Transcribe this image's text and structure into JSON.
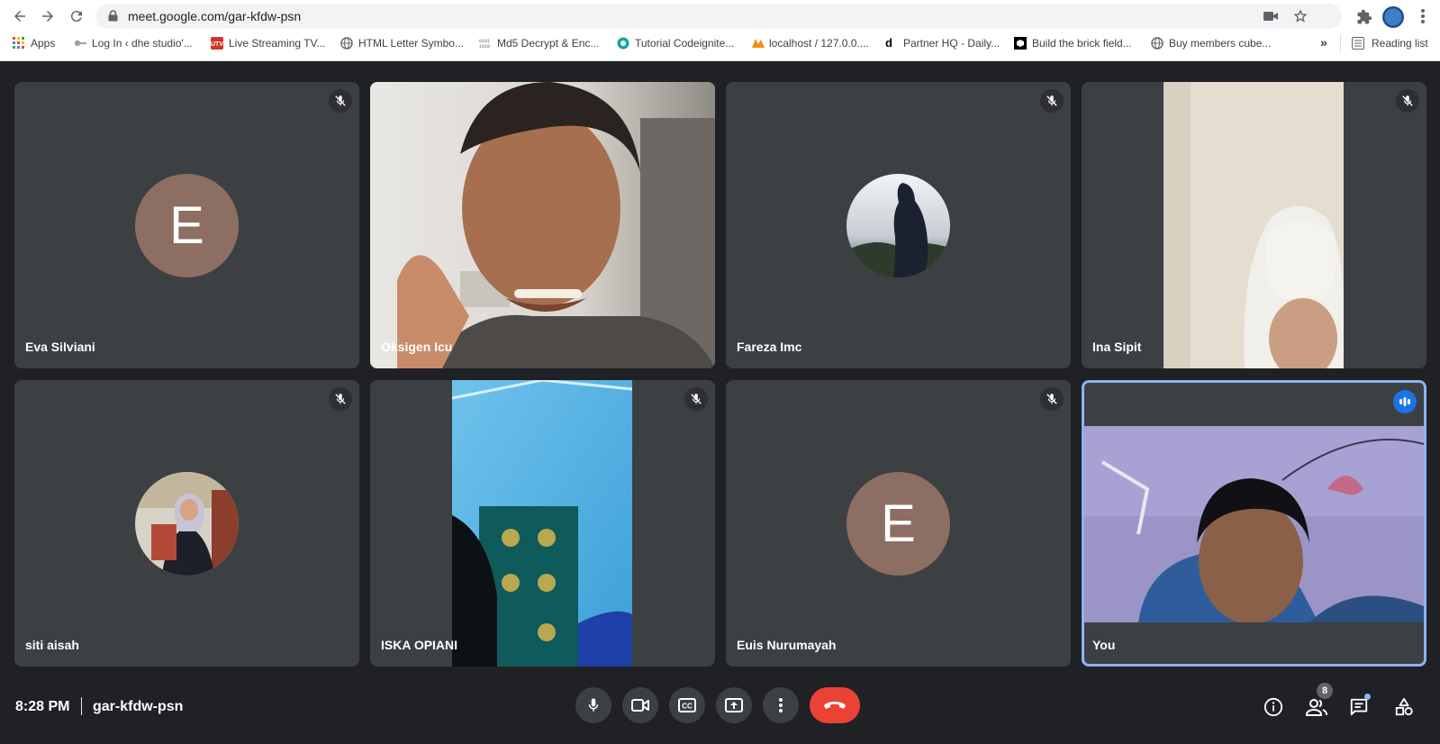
{
  "browser": {
    "url": "meet.google.com/gar-kfdw-psn",
    "bookmarks": [
      {
        "label": "Apps",
        "icon": "apps-grid-icon"
      },
      {
        "label": "Log In ‹ dhe studio'...",
        "icon": "key-icon"
      },
      {
        "label": "Live Streaming TV...",
        "icon": "tv-logo-icon"
      },
      {
        "label": "HTML Letter Symbo...",
        "icon": "globe-icon"
      },
      {
        "label": "Md5 Decrypt & Enc...",
        "icon": "binary-icon"
      },
      {
        "label": "Tutorial Codeignite...",
        "icon": "codeigniter-icon"
      },
      {
        "label": "localhost / 127.0.0....",
        "icon": "phpmyadmin-icon"
      },
      {
        "label": "Partner HQ - Daily...",
        "icon": "d-logo-icon"
      },
      {
        "label": "Build the brick field...",
        "icon": "brick-icon"
      },
      {
        "label": "Buy members cube...",
        "icon": "globe-icon"
      }
    ],
    "reading_list": "Reading list"
  },
  "participants": [
    {
      "name": "Eva Silviani",
      "avatar": "E",
      "muted": true
    },
    {
      "name": "Oksigen Icu",
      "muted": false
    },
    {
      "name": "Fareza Imc",
      "muted": true
    },
    {
      "name": "Ina Sipit",
      "muted": true
    },
    {
      "name": "siti aisah",
      "muted": true
    },
    {
      "name": "ISKA OPIANI",
      "muted": true
    },
    {
      "name": "Euis Nurumayah",
      "avatar": "E",
      "muted": true
    },
    {
      "name": "You",
      "speaking": true
    }
  ],
  "meeting": {
    "time": "8:28 PM",
    "code": "gar-kfdw-psn",
    "participant_count": "8"
  },
  "colors": {
    "background": "#202124",
    "tile": "#3c4043",
    "avatar": "#8d6e63",
    "end_call": "#ea4335",
    "active_speaker": "#8ab4f8"
  }
}
